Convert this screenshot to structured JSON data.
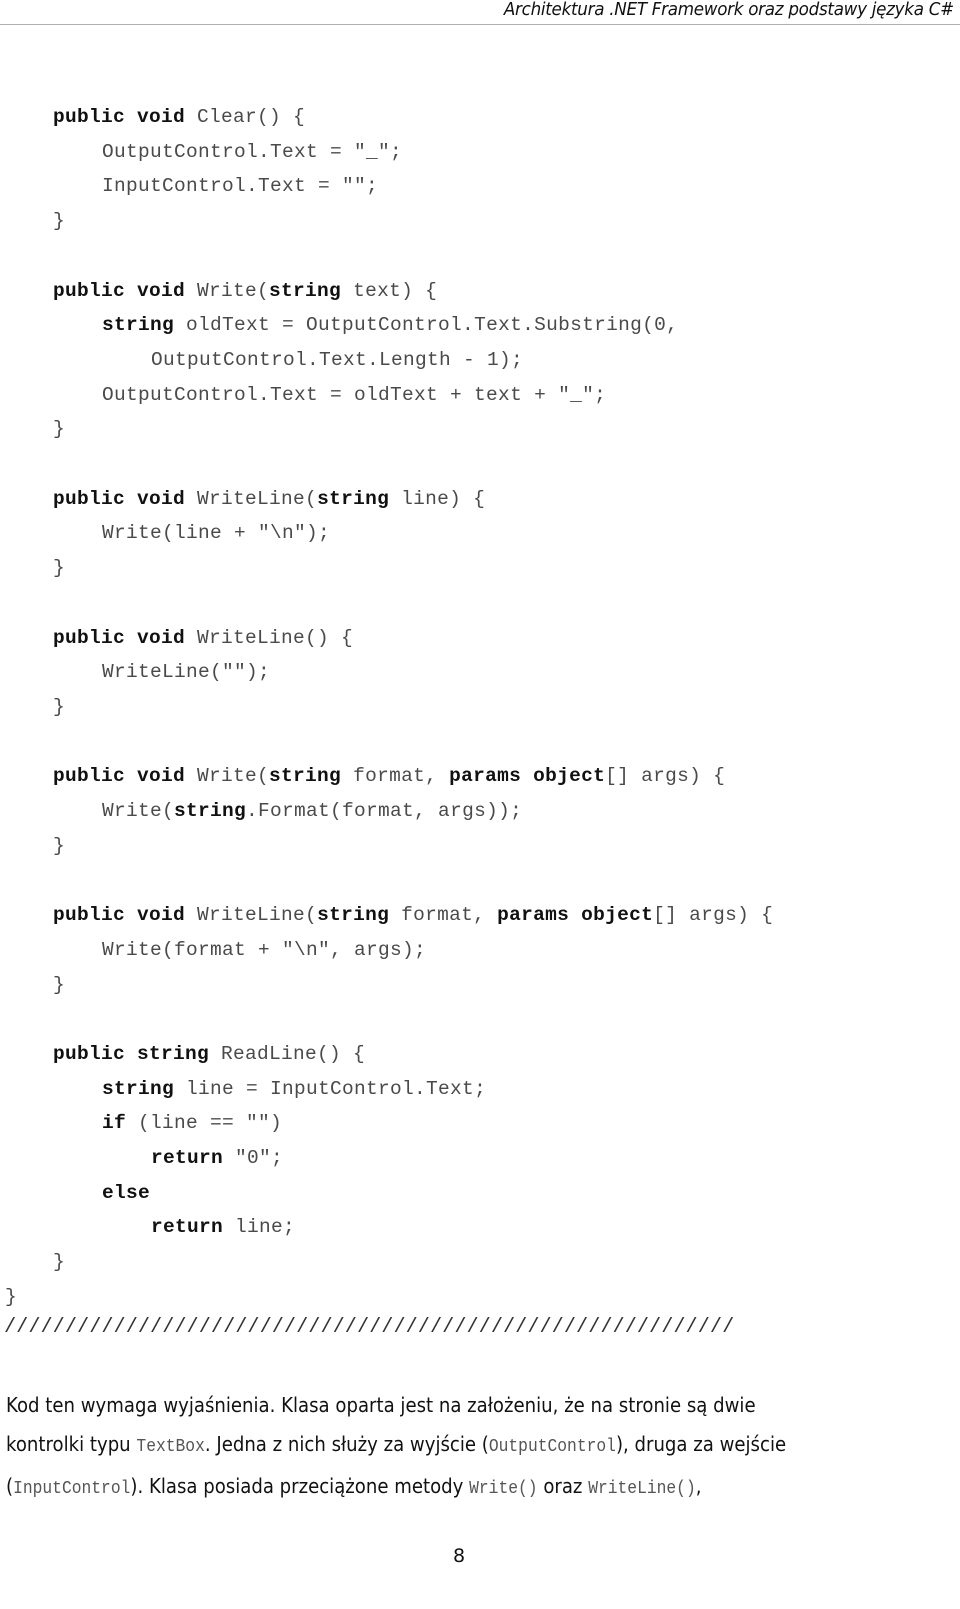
{
  "header": {
    "title": "Architektura .NET Framework oraz podstawy języka C#"
  },
  "code": {
    "lines": [
      {
        "indent": 1,
        "tokens": [
          {
            "t": "public void",
            "k": true
          },
          {
            "t": " Clear() {"
          }
        ]
      },
      {
        "indent": 2,
        "tokens": [
          {
            "t": "OutputControl.Text = \"_\";"
          }
        ]
      },
      {
        "indent": 2,
        "tokens": [
          {
            "t": "InputControl.Text = \"\";"
          }
        ]
      },
      {
        "indent": 1,
        "tokens": [
          {
            "t": "}"
          }
        ]
      },
      {
        "indent": 0,
        "tokens": []
      },
      {
        "indent": 1,
        "tokens": [
          {
            "t": "public void",
            "k": true
          },
          {
            "t": " Write("
          },
          {
            "t": "string",
            "k": true
          },
          {
            "t": " text) {"
          }
        ]
      },
      {
        "indent": 2,
        "tokens": [
          {
            "t": "string",
            "k": true
          },
          {
            "t": " oldText = OutputControl.Text.Substring(0,"
          }
        ]
      },
      {
        "indent": 3,
        "tokens": [
          {
            "t": "OutputControl.Text.Length - 1);"
          }
        ]
      },
      {
        "indent": 2,
        "tokens": [
          {
            "t": "OutputControl.Text = oldText + text + \"_\";"
          }
        ]
      },
      {
        "indent": 1,
        "tokens": [
          {
            "t": "}"
          }
        ]
      },
      {
        "indent": 0,
        "tokens": []
      },
      {
        "indent": 1,
        "tokens": [
          {
            "t": "public void",
            "k": true
          },
          {
            "t": " WriteLine("
          },
          {
            "t": "string",
            "k": true
          },
          {
            "t": " line) {"
          }
        ]
      },
      {
        "indent": 2,
        "tokens": [
          {
            "t": "Write(line + \"\\n\");"
          }
        ]
      },
      {
        "indent": 1,
        "tokens": [
          {
            "t": "}"
          }
        ]
      },
      {
        "indent": 0,
        "tokens": []
      },
      {
        "indent": 1,
        "tokens": [
          {
            "t": "public void",
            "k": true
          },
          {
            "t": " WriteLine() {"
          }
        ]
      },
      {
        "indent": 2,
        "tokens": [
          {
            "t": "WriteLine(\"\");"
          }
        ]
      },
      {
        "indent": 1,
        "tokens": [
          {
            "t": "}"
          }
        ]
      },
      {
        "indent": 0,
        "tokens": []
      },
      {
        "indent": 1,
        "tokens": [
          {
            "t": "public void",
            "k": true
          },
          {
            "t": " Write("
          },
          {
            "t": "string",
            "k": true
          },
          {
            "t": " format, "
          },
          {
            "t": "params object",
            "k": true
          },
          {
            "t": "[] args) {"
          }
        ]
      },
      {
        "indent": 2,
        "tokens": [
          {
            "t": "Write("
          },
          {
            "t": "string",
            "k": true
          },
          {
            "t": ".Format(format, args));"
          }
        ]
      },
      {
        "indent": 1,
        "tokens": [
          {
            "t": "}"
          }
        ]
      },
      {
        "indent": 0,
        "tokens": []
      },
      {
        "indent": 1,
        "tokens": [
          {
            "t": "public void",
            "k": true
          },
          {
            "t": " WriteLine("
          },
          {
            "t": "string",
            "k": true
          },
          {
            "t": " format, "
          },
          {
            "t": "params object",
            "k": true
          },
          {
            "t": "[] args) {"
          }
        ]
      },
      {
        "indent": 2,
        "tokens": [
          {
            "t": "Write(format + \"\\n\", args);"
          }
        ]
      },
      {
        "indent": 1,
        "tokens": [
          {
            "t": "}"
          }
        ]
      },
      {
        "indent": 0,
        "tokens": []
      },
      {
        "indent": 1,
        "tokens": [
          {
            "t": "public string",
            "k": true
          },
          {
            "t": " ReadLine() {"
          }
        ]
      },
      {
        "indent": 2,
        "tokens": [
          {
            "t": "string",
            "k": true
          },
          {
            "t": " line = InputControl.Text;"
          }
        ]
      },
      {
        "indent": 2,
        "tokens": [
          {
            "t": "if",
            "k": true
          },
          {
            "t": " (line == \"\")"
          }
        ]
      },
      {
        "indent": 3,
        "tokens": [
          {
            "t": "return",
            "k": true
          },
          {
            "t": " \"0\";"
          }
        ]
      },
      {
        "indent": 2,
        "tokens": [
          {
            "t": "else",
            "k": true
          }
        ]
      },
      {
        "indent": 3,
        "tokens": [
          {
            "t": "return",
            "k": true
          },
          {
            "t": " line;"
          }
        ]
      },
      {
        "indent": 1,
        "tokens": [
          {
            "t": "}"
          }
        ]
      },
      {
        "indent": 0,
        "tokens": [
          {
            "t": "}"
          }
        ]
      }
    ],
    "separator": "////////////////////////////////////////////////////////////"
  },
  "prose": {
    "lines": [
      [
        {
          "t": "Kod ten wymaga wyjaśnienia. Klasa oparta jest na założeniu, że na stronie są dwie"
        }
      ],
      [
        {
          "t": "kontrolki typu "
        },
        {
          "t": "TextBox",
          "mono": true
        },
        {
          "t": ". Jedna z nich służy za wyjście ("
        },
        {
          "t": "OutputControl",
          "mono": true
        },
        {
          "t": "), druga za wejście"
        }
      ],
      [
        {
          "t": "("
        },
        {
          "t": "InputControl",
          "mono": true
        },
        {
          "t": "). Klasa posiada przeciążone metody "
        },
        {
          "t": "Write()",
          "mono": true
        },
        {
          "t": " oraz "
        },
        {
          "t": "WriteLine()",
          "mono": true
        },
        {
          "t": ","
        }
      ]
    ]
  },
  "footer": {
    "page_number": "8"
  }
}
